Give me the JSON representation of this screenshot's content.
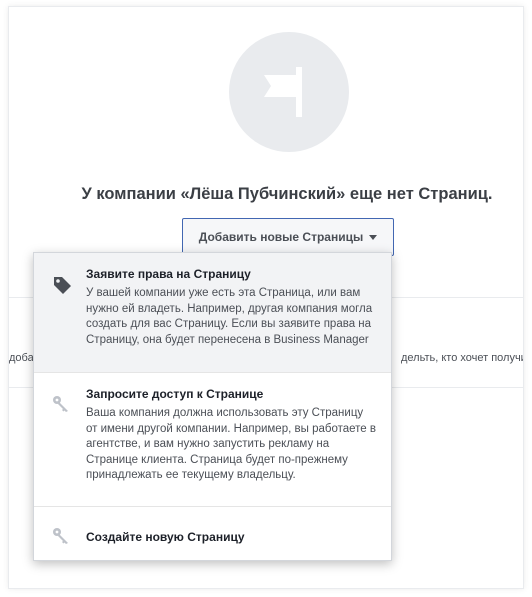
{
  "empty_state": {
    "icon": "flag-icon",
    "title": "У компании «Лёша Пубчинский» еще нет Страниц.",
    "add_button_label": "Добавить новые Страницы"
  },
  "background": {
    "left_text": "доба",
    "right_text": "дельть, кто хочет получить"
  },
  "dropdown": {
    "items": [
      {
        "icon": "tag-icon",
        "title": "Заявите права на Страницу",
        "description": "У вашей компании уже есть эта Страница, или вам нужно ей владеть. Например, другая компания могла создать для вас Страницу. Если вы заявите права на Страницу, она будет перенесена в Business Manager"
      },
      {
        "icon": "key-icon",
        "title": "Запросите доступ к Странице",
        "description": "Ваша компания должна использовать эту Страницу от имени другой компании. Например, вы работаете в агентстве, и вам нужно запустить рекламу на Странице клиента. Страница будет по-прежнему принадлежать ее текущему владельцу."
      },
      {
        "icon": "key-icon",
        "title": "Создайте новую Страницу",
        "description": ""
      }
    ]
  }
}
